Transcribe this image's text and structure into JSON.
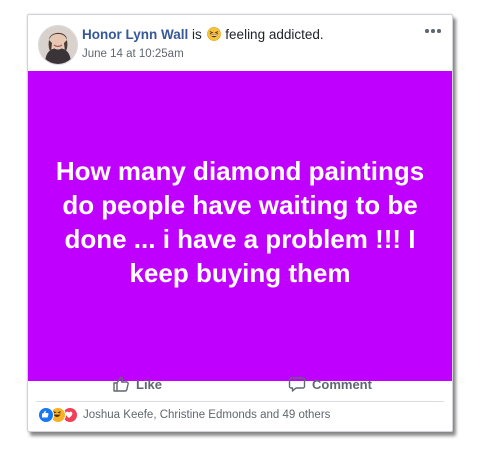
{
  "post": {
    "author": "Honor Lynn Wall",
    "verb": "is",
    "feeling": "feeling addicted.",
    "feeling_icon": "grinning-squinting-emoji",
    "timestamp": "June 14 at 10:25am",
    "text": "How many diamond paintings do people have waiting to be done ... i have a problem !!! I keep buying them",
    "background_color": "#c000fe"
  },
  "actions": {
    "like_label": "Like",
    "comment_label": "Comment"
  },
  "reactions": {
    "icons": [
      "like-reaction-icon",
      "haha-reaction-icon",
      "love-reaction-icon"
    ],
    "summary": "Joshua Keefe, Christine Edmonds and 49 others"
  },
  "colors": {
    "author_link": "#365899",
    "secondary_text": "#606770",
    "like_blue": "#1877f2",
    "love_red": "#f33e58",
    "haha_yellow": "#f7b125"
  }
}
